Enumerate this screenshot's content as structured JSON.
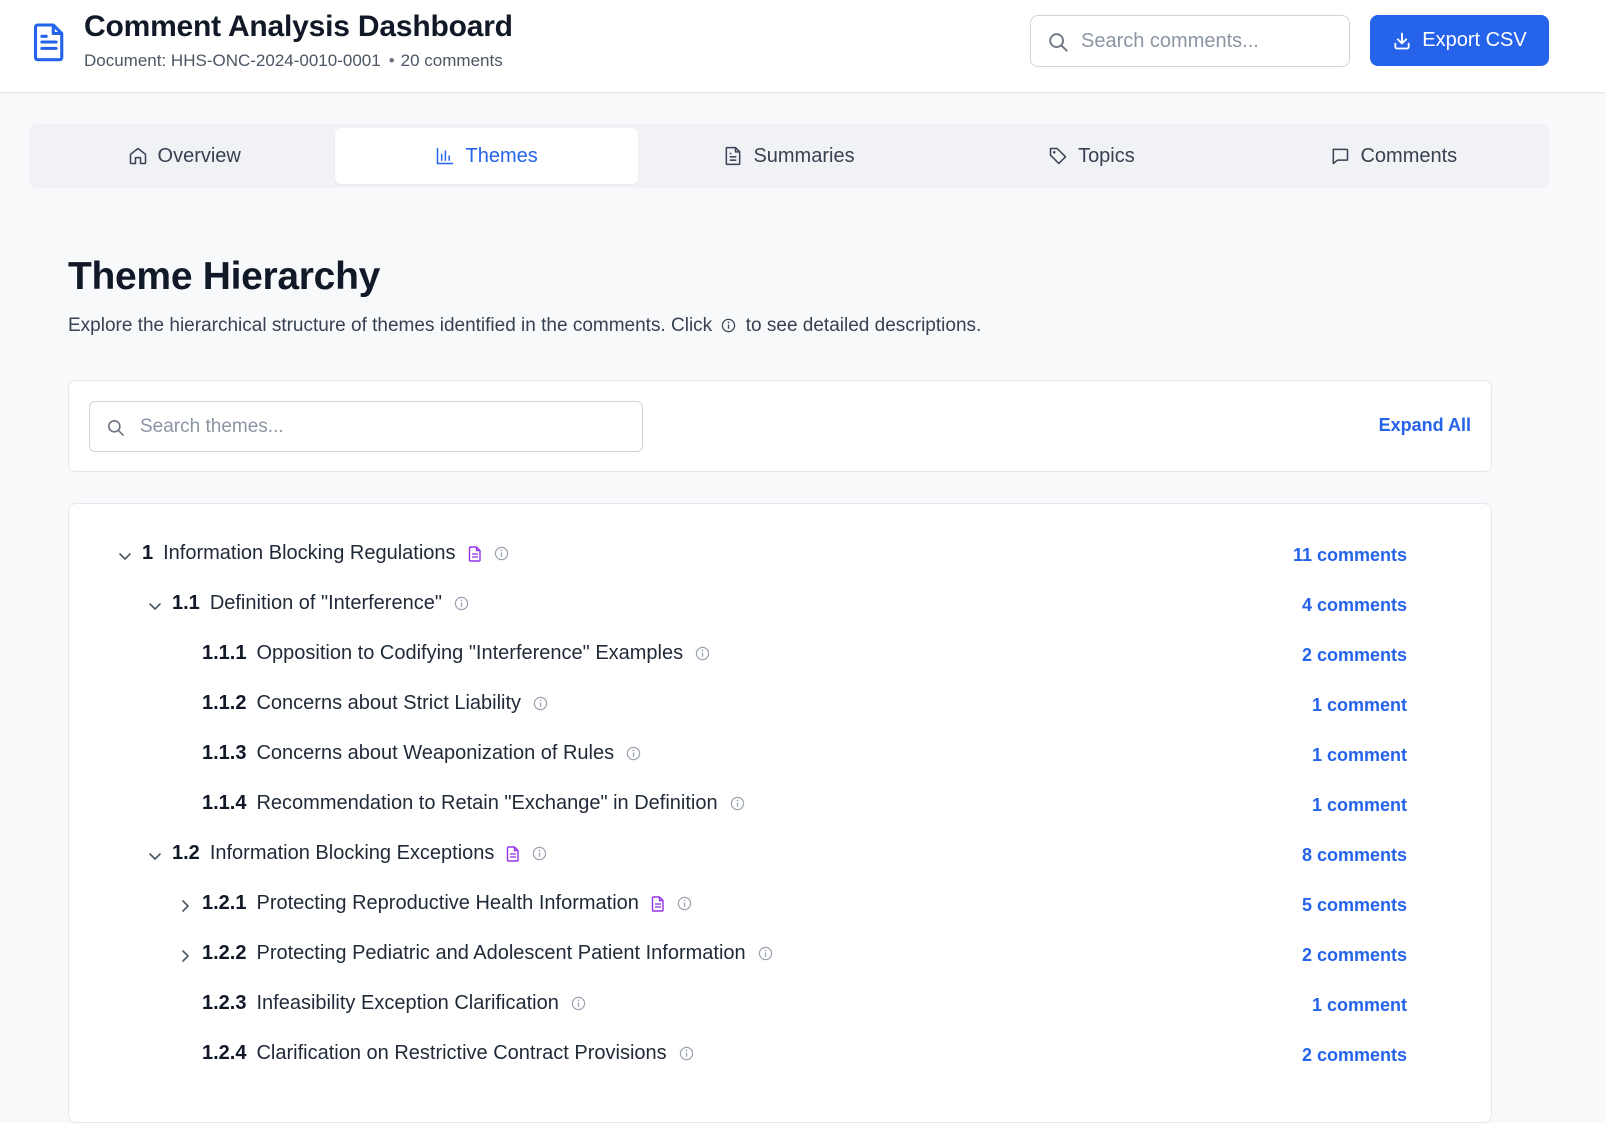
{
  "header": {
    "title": "Comment Analysis Dashboard",
    "document_label": "Document: HHS-ONC-2024-0010-0001",
    "comment_count": "20 comments",
    "search_placeholder": "Search comments...",
    "export_label": "Export CSV"
  },
  "tabs": [
    {
      "label": "Overview",
      "icon": "home-icon",
      "active": false
    },
    {
      "label": "Themes",
      "icon": "bar-chart-icon",
      "active": true
    },
    {
      "label": "Summaries",
      "icon": "document-icon",
      "active": false
    },
    {
      "label": "Topics",
      "icon": "tag-icon",
      "active": false
    },
    {
      "label": "Comments",
      "icon": "message-icon",
      "active": false
    }
  ],
  "page": {
    "title": "Theme Hierarchy",
    "description_before": "Explore the hierarchical structure of themes identified in the comments. Click",
    "description_after": "to see detailed descriptions."
  },
  "theme_search": {
    "placeholder": "Search themes...",
    "expand_all": "Expand All"
  },
  "themes": [
    {
      "num": "1",
      "label": "Information Blocking Regulations",
      "count": "11 comments",
      "level": 0,
      "chevron": "down",
      "has_summary": true
    },
    {
      "num": "1.1",
      "label": "Definition of \"Interference\"",
      "count": "4 comments",
      "level": 1,
      "chevron": "down",
      "has_summary": false
    },
    {
      "num": "1.1.1",
      "label": "Opposition to Codifying \"Interference\" Examples",
      "count": "2 comments",
      "level": 2,
      "chevron": "none",
      "has_summary": false
    },
    {
      "num": "1.1.2",
      "label": "Concerns about Strict Liability",
      "count": "1 comment",
      "level": 2,
      "chevron": "none",
      "has_summary": false
    },
    {
      "num": "1.1.3",
      "label": "Concerns about Weaponization of Rules",
      "count": "1 comment",
      "level": 2,
      "chevron": "none",
      "has_summary": false
    },
    {
      "num": "1.1.4",
      "label": "Recommendation to Retain \"Exchange\" in Definition",
      "count": "1 comment",
      "level": 2,
      "chevron": "none",
      "has_summary": false
    },
    {
      "num": "1.2",
      "label": "Information Blocking Exceptions",
      "count": "8 comments",
      "level": 1,
      "chevron": "down",
      "has_summary": true
    },
    {
      "num": "1.2.1",
      "label": "Protecting Reproductive Health Information",
      "count": "5 comments",
      "level": 2,
      "chevron": "right",
      "has_summary": true
    },
    {
      "num": "1.2.2",
      "label": "Protecting Pediatric and Adolescent Patient Information",
      "count": "2 comments",
      "level": 2,
      "chevron": "right",
      "has_summary": false
    },
    {
      "num": "1.2.3",
      "label": "Infeasibility Exception Clarification",
      "count": "1 comment",
      "level": 2,
      "chevron": "none",
      "has_summary": false
    },
    {
      "num": "1.2.4",
      "label": "Clarification on Restrictive Contract Provisions",
      "count": "2 comments",
      "level": 2,
      "chevron": "none",
      "has_summary": false
    }
  ],
  "colors": {
    "accent": "#2563eb",
    "summary_icon": "#9333ea",
    "info_icon": "#9ca3af"
  }
}
